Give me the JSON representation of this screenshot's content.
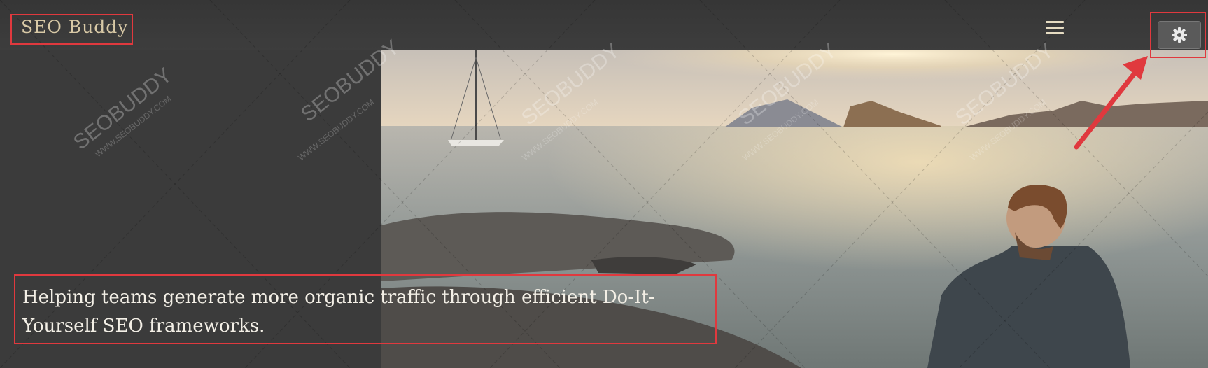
{
  "header": {
    "brand": "SEO Buddy",
    "menu_icon": "hamburger-menu-icon",
    "settings_icon": "gear-icon"
  },
  "hero": {
    "tagline": "Helping teams generate more organic traffic through efficient Do-It-Yourself SEO frameworks."
  },
  "watermark": {
    "brand": "SEOBUDDY",
    "url": "WWW.SEOBUDDY.COM"
  },
  "colors": {
    "annotation_red": "#e0393e",
    "brand_text": "#d8c9a6",
    "background": "#3b3b3b"
  }
}
